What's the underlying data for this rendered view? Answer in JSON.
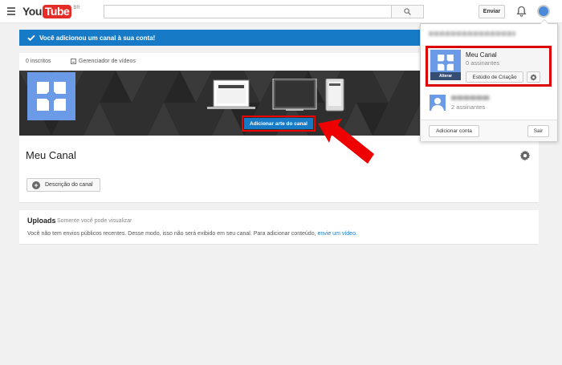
{
  "header": {
    "logo_you": "You",
    "logo_tube": "Tube",
    "logo_region": "BR",
    "search_placeholder": "",
    "upload_label": "Enviar"
  },
  "notice": {
    "message": "Você adicionou um canal à sua conta!"
  },
  "channel": {
    "subscribers": "0 inscritos",
    "video_manager": "Gerenciador de vídeos",
    "add_art_label": "Adicionar arte do canal",
    "title": "Meu Canal",
    "description_button": "Descrição do canal"
  },
  "uploads": {
    "title": "Uploads",
    "subtitle": "Somente você pode visualizar",
    "text": "Você não tem envios públicos recentes. Desse modo, isso não será exibido em seu canal. Para adicionar conteúdo,",
    "link": "envie um vídeo."
  },
  "account_menu": {
    "current_account": {
      "name": "Meu Canal",
      "subscribers": "0 assinantes",
      "change_label": "Alterar",
      "studio_label": "Estúdio de Criação"
    },
    "other_account": {
      "subscribers": "2 assinantes"
    },
    "add_account_label": "Adicionar conta",
    "logout_label": "Sair"
  },
  "colors": {
    "accent": "#167ac6",
    "brand": "#e52d27",
    "highlight": "#dd0000"
  }
}
